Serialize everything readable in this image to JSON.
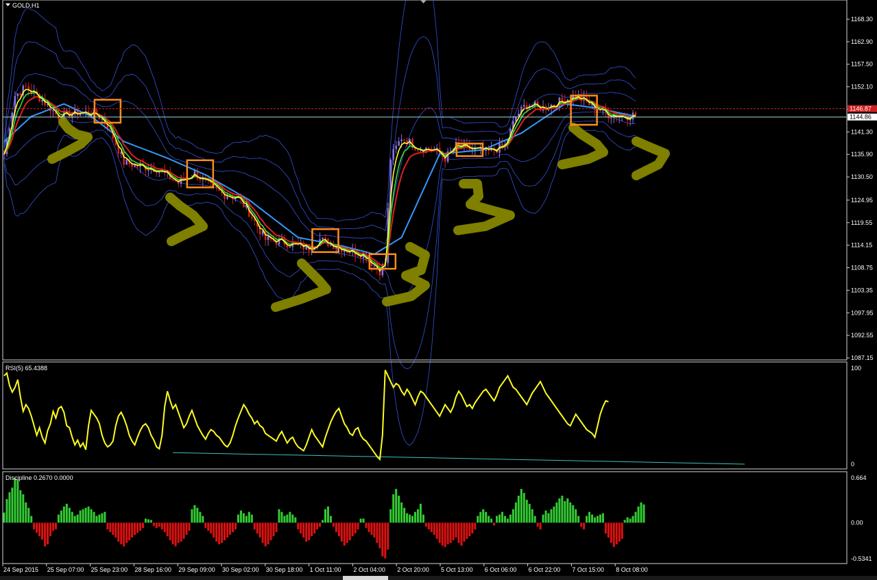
{
  "window": {
    "title": "GOLD,H1"
  },
  "colors": {
    "background": "#000000",
    "frame": "#d8d8d8",
    "bullCandle": "#8a6fe0",
    "bearCandle": "#d11f1f",
    "emaFast": "#ffff33",
    "emaMid": "#33dd33",
    "emaSlow": "#e02020",
    "maLong": "#3399ff",
    "bands": "#4060ff",
    "rsi": "#ffff20",
    "rsiBase": "#40c0c0",
    "histUp": "#33cc33",
    "histDown": "#dd1111",
    "annotation": "#8a8a00",
    "box": "#ff8c1a",
    "priceLine": "#a0d8d8",
    "bidLine": "#cc2020"
  },
  "icons": {
    "menu": "triangle-down-icon",
    "scroll": "triangle-down-icon"
  },
  "chart_data": [
    {
      "type": "candlestick",
      "title": "GOLD,H1",
      "ylim": [
        1085.0,
        1171.0
      ],
      "y_ticks": [
        "1168.30",
        "1162.90",
        "1157.50",
        "1152.10",
        "1146.70",
        "1141.30",
        "1135.90",
        "1130.50",
        "1124.95",
        "1119.55",
        "1114.15",
        "1108.75",
        "1103.35",
        "1097.95",
        "1092.55",
        "1087.15"
      ],
      "price_markers": {
        "bid": "1146.87",
        "current": "1144.86"
      },
      "x_ticks": [
        "24 Sep 2015",
        "25 Sep 07:00",
        "25 Sep 23:00",
        "28 Sep 16:00",
        "29 Sep 09:00",
        "30 Sep 02:00",
        "30 Sep 18:00",
        "1 Oct 11:00",
        "2 Oct 04:00",
        "2 Oct 20:00",
        "5 Oct 13:00",
        "6 Oct 06:00",
        "6 Oct 22:00",
        "7 Oct 15:00",
        "8 Oct 08:00"
      ],
      "price_path": [
        [
          0,
          1136.0
        ],
        [
          4,
          1150.0
        ],
        [
          8,
          1152.0
        ],
        [
          14,
          1149.0
        ],
        [
          20,
          1145.0
        ],
        [
          28,
          1146.0
        ],
        [
          34,
          1145.5
        ],
        [
          38,
          1143.0
        ],
        [
          44,
          1134.0
        ],
        [
          50,
          1133.0
        ],
        [
          56,
          1132.5
        ],
        [
          64,
          1129.0
        ],
        [
          70,
          1131.5
        ],
        [
          74,
          1129.0
        ],
        [
          80,
          1126.5
        ],
        [
          86,
          1125.5
        ],
        [
          90,
          1122.0
        ],
        [
          96,
          1115.5
        ],
        [
          102,
          1115.0
        ],
        [
          108,
          1114.0
        ],
        [
          112,
          1113.5
        ],
        [
          116,
          1115.5
        ],
        [
          120,
          1114.5
        ],
        [
          126,
          1113.0
        ],
        [
          132,
          1112.0
        ],
        [
          138,
          1108.0
        ],
        [
          140,
          1110.0
        ],
        [
          142,
          1135.0
        ],
        [
          146,
          1140.0
        ],
        [
          152,
          1137.5
        ],
        [
          158,
          1137.0
        ],
        [
          162,
          1135.0
        ],
        [
          166,
          1138.0
        ],
        [
          172,
          1137.0
        ],
        [
          178,
          1136.5
        ],
        [
          184,
          1138.0
        ],
        [
          188,
          1145.0
        ],
        [
          192,
          1148.0
        ],
        [
          198,
          1147.0
        ],
        [
          204,
          1148.5
        ],
        [
          210,
          1150.0
        ],
        [
          216,
          1147.5
        ],
        [
          222,
          1145.5
        ],
        [
          228,
          1145.0
        ],
        [
          232,
          1145.5
        ]
      ],
      "ma_long_path": [
        [
          0,
          1139.0
        ],
        [
          10,
          1145.0
        ],
        [
          22,
          1148.0
        ],
        [
          32,
          1145.0
        ],
        [
          44,
          1139.0
        ],
        [
          60,
          1135.0
        ],
        [
          74,
          1131.0
        ],
        [
          90,
          1125.0
        ],
        [
          108,
          1116.0
        ],
        [
          124,
          1114.0
        ],
        [
          136,
          1112.0
        ],
        [
          146,
          1116.0
        ],
        [
          160,
          1136.0
        ],
        [
          176,
          1137.0
        ],
        [
          190,
          1141.0
        ],
        [
          206,
          1148.0
        ],
        [
          218,
          1147.0
        ],
        [
          232,
          1145.0
        ]
      ],
      "boxes": [
        {
          "bar": 38,
          "low": 1143.5,
          "high": 1149.0
        },
        {
          "bar": 72,
          "low": 1128.0,
          "high": 1134.5
        },
        {
          "bar": 118,
          "low": 1112.5,
          "high": 1118.0
        },
        {
          "bar": 139,
          "low": 1108.5,
          "high": 1112.0
        },
        {
          "bar": 171,
          "low": 1135.5,
          "high": 1138.5
        },
        {
          "bar": 213,
          "low": 1143.0,
          "high": 1150.0
        }
      ],
      "series": [
        {
          "type": "candlestick"
        },
        {
          "type": "line",
          "style": "ema-fast"
        },
        {
          "type": "line",
          "style": "ema-mid"
        },
        {
          "type": "line",
          "style": "ema-slow"
        },
        {
          "type": "line",
          "style": "ma-long"
        },
        {
          "type": "band",
          "style": "bollinger"
        }
      ]
    },
    {
      "type": "line",
      "title": "RSI(5) 65.4388",
      "ylim": [
        0,
        100
      ],
      "y_ticks": [
        "100",
        "0"
      ],
      "values": [
        92,
        95,
        82,
        75,
        80,
        88,
        70,
        55,
        62,
        58,
        50,
        40,
        30,
        38,
        28,
        22,
        35,
        42,
        55,
        48,
        58,
        60,
        54,
        40,
        38,
        28,
        20,
        25,
        18,
        22,
        15,
        40,
        56,
        52,
        48,
        42,
        30,
        22,
        18,
        20,
        24,
        40,
        50,
        54,
        48,
        40,
        30,
        24,
        20,
        28,
        35,
        40,
        42,
        38,
        30,
        25,
        18,
        16,
        30,
        60,
        76,
        66,
        58,
        62,
        54,
        46,
        38,
        42,
        50,
        56,
        48,
        40,
        35,
        30,
        26,
        32,
        36,
        34,
        30,
        28,
        24,
        20,
        18,
        22,
        30,
        40,
        48,
        55,
        62,
        58,
        52,
        48,
        42,
        45,
        40,
        38,
        32,
        30,
        28,
        26,
        24,
        30,
        34,
        28,
        22,
        26,
        28,
        22,
        18,
        16,
        14,
        20,
        28,
        36,
        30,
        26,
        22,
        18,
        28,
        36,
        44,
        50,
        55,
        58,
        50,
        42,
        38,
        32,
        30,
        36,
        38,
        30,
        26,
        24,
        20,
        16,
        12,
        8,
        5,
        30,
        98,
        92,
        86,
        80,
        84,
        82,
        76,
        72,
        78,
        74,
        68,
        62,
        70,
        76,
        74,
        70,
        66,
        62,
        58,
        54,
        50,
        56,
        62,
        58,
        54,
        60,
        70,
        76,
        72,
        66,
        60,
        62,
        58,
        64,
        68,
        72,
        76,
        78,
        74,
        70,
        66,
        72,
        80,
        84,
        88,
        92,
        86,
        80,
        78,
        74,
        70,
        66,
        62,
        68,
        74,
        78,
        82,
        86,
        80,
        74,
        70,
        66,
        62,
        58,
        54,
        50,
        46,
        42,
        40,
        46,
        52,
        48,
        44,
        40,
        36,
        34,
        32,
        28,
        40,
        52,
        60,
        66,
        65
      ],
      "baseline": [
        [
          252,
          12
        ],
        [
          1086,
          0
        ]
      ]
    },
    {
      "type": "bar",
      "title": "Discipline 0.2670 0.0000",
      "ylim": [
        -0.5341,
        0.664
      ],
      "y_ticks": [
        "0.664",
        "0.00",
        "-0.5341"
      ],
      "values": [
        0.15,
        0.35,
        0.45,
        0.52,
        0.66,
        0.64,
        0.48,
        0.42,
        0.3,
        0.22,
        0.1,
        -0.1,
        -0.15,
        -0.2,
        -0.25,
        -0.35,
        -0.32,
        -0.2,
        -0.12,
        -0.1,
        0.12,
        0.18,
        0.24,
        0.28,
        0.22,
        0.16,
        0.1,
        0.12,
        0.18,
        0.2,
        0.22,
        0.24,
        0.2,
        0.16,
        0.1,
        0.12,
        0.14,
        0.16,
        -0.1,
        -0.14,
        -0.18,
        -0.22,
        -0.28,
        -0.32,
        -0.35,
        -0.3,
        -0.26,
        -0.22,
        -0.18,
        -0.15,
        -0.12,
        -0.08,
        0.06,
        0.05,
        0.04,
        -0.05,
        -0.08,
        -0.06,
        -0.1,
        -0.14,
        -0.2,
        -0.26,
        -0.32,
        -0.35,
        -0.3,
        -0.28,
        -0.24,
        -0.18,
        -0.12,
        0.2,
        0.26,
        0.22,
        0.16,
        0.1,
        -0.08,
        -0.12,
        -0.16,
        -0.22,
        -0.28,
        -0.32,
        -0.3,
        -0.26,
        -0.22,
        -0.18,
        -0.14,
        -0.1,
        0.12,
        0.18,
        0.14,
        0.1,
        0.16,
        0.12,
        -0.1,
        -0.16,
        -0.22,
        -0.3,
        -0.35,
        -0.32,
        -0.26,
        -0.2,
        -0.14,
        0.2,
        0.16,
        0.1,
        0.12,
        0.16,
        0.12,
        0.08,
        -0.1,
        -0.16,
        -0.22,
        -0.28,
        -0.26,
        -0.2,
        -0.16,
        -0.1,
        -0.06,
        0.04,
        0.2,
        0.24,
        0.1,
        -0.06,
        -0.14,
        -0.2,
        -0.28,
        -0.34,
        -0.3,
        -0.26,
        -0.2,
        -0.16,
        -0.1,
        0.06,
        0.06,
        -0.08,
        -0.14,
        -0.18,
        -0.22,
        -0.3,
        -0.38,
        -0.5,
        -0.53,
        -0.4,
        0.2,
        0.42,
        0.5,
        0.4,
        0.3,
        0.22,
        0.14,
        0.12,
        0.1,
        0.16,
        0.2,
        0.28,
        0.12,
        -0.06,
        -0.1,
        -0.14,
        -0.18,
        -0.24,
        -0.3,
        -0.34,
        -0.36,
        -0.32,
        -0.3,
        -0.26,
        -0.22,
        -0.3,
        -0.34,
        -0.28,
        -0.24,
        -0.2,
        -0.16,
        -0.1,
        0.1,
        0.16,
        0.2,
        0.16,
        0.1,
        0.06,
        -0.04,
        0.1,
        0.12,
        0.16,
        0.1,
        0.06,
        0.12,
        0.2,
        0.3,
        0.4,
        0.5,
        0.44,
        0.34,
        0.28,
        0.2,
        0.1,
        -0.06,
        -0.1,
        0.12,
        0.18,
        0.14,
        0.2,
        0.24,
        0.3,
        0.36,
        0.4,
        0.32,
        0.36,
        0.3,
        0.26,
        0.2,
        0.1,
        -0.06,
        -0.1,
        0.1,
        0.16,
        0.12,
        0.08,
        0.1,
        0.12,
        0.14,
        -0.16,
        -0.22,
        -0.3,
        -0.36,
        -0.32,
        -0.28,
        -0.24,
        0.04,
        0.08,
        0.06,
        0.1,
        0.16,
        0.24,
        0.3,
        0.27
      ]
    }
  ]
}
